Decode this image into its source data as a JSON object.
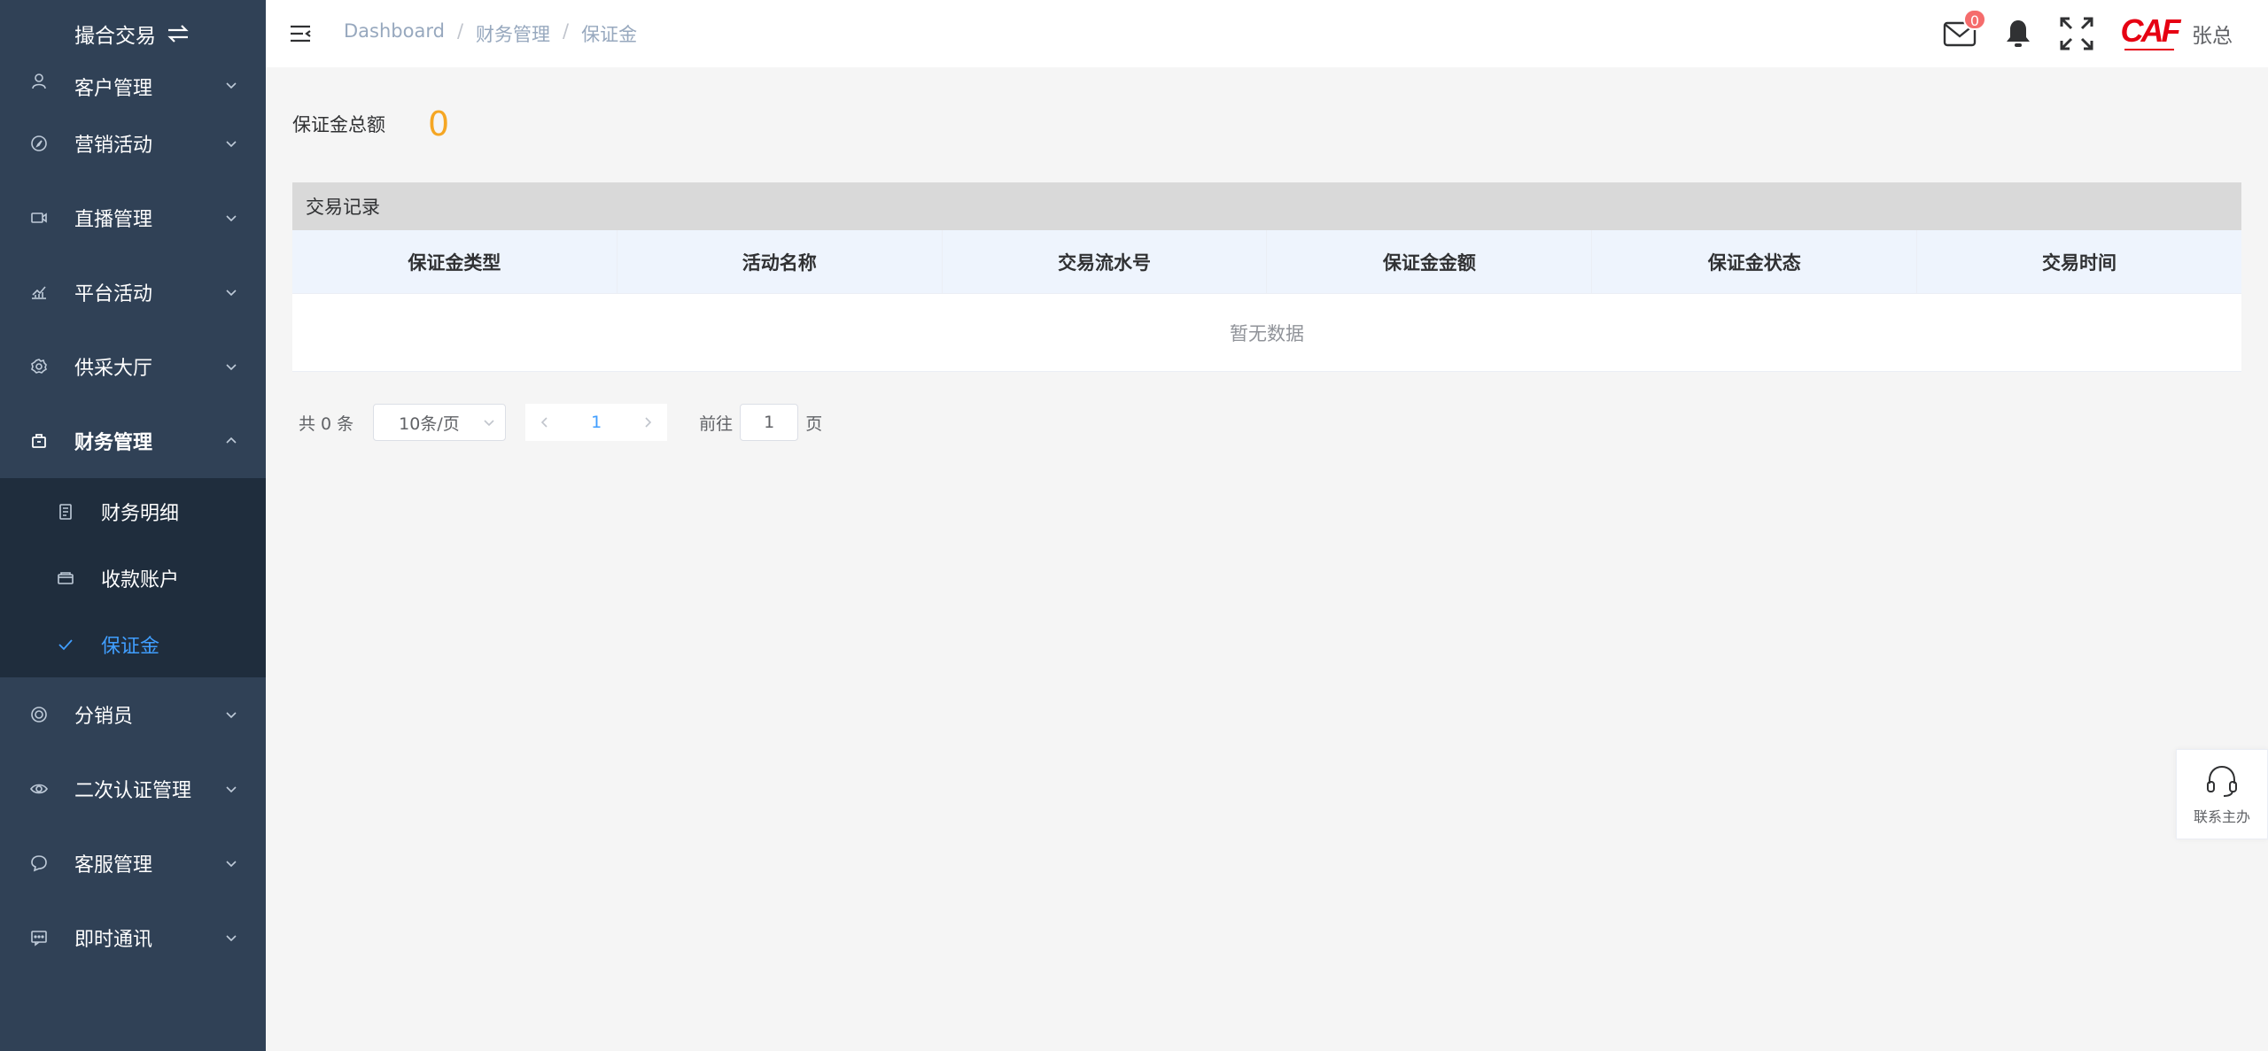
{
  "sidebar": {
    "brand": "撮合交易",
    "items": [
      {
        "label": "客户管理",
        "icon": "user-icon"
      },
      {
        "label": "营销活动",
        "icon": "compass-icon"
      },
      {
        "label": "直播管理",
        "icon": "video-icon"
      },
      {
        "label": "平台活动",
        "icon": "chart-icon"
      },
      {
        "label": "供采大厅",
        "icon": "gear-icon"
      },
      {
        "label": "财务管理",
        "icon": "wallet-icon"
      },
      {
        "label": "分销员",
        "icon": "target-icon"
      },
      {
        "label": "二次认证管理",
        "icon": "eye-icon"
      },
      {
        "label": "客服管理",
        "icon": "chat-icon"
      },
      {
        "label": "即时通讯",
        "icon": "message-icon"
      }
    ],
    "finance_sub": [
      {
        "label": "财务明细",
        "icon": "document-icon"
      },
      {
        "label": "收款账户",
        "icon": "card-icon"
      },
      {
        "label": "保证金",
        "icon": "check-icon"
      }
    ]
  },
  "header": {
    "breadcrumb": [
      "Dashboard",
      "财务管理",
      "保证金"
    ],
    "mail_badge": "0",
    "logo_text": "CAF",
    "username": "张总"
  },
  "main": {
    "total_label": "保证金总额",
    "total_value": "0",
    "table_title": "交易记录",
    "columns": [
      "保证金类型",
      "活动名称",
      "交易流水号",
      "保证金金额",
      "保证金状态",
      "交易时间"
    ],
    "empty_text": "暂无数据",
    "pager": {
      "total": "共 0 条",
      "size": "10条/页",
      "current": "1",
      "goto_label": "前往",
      "goto_value": "1",
      "page_suffix": "页"
    }
  },
  "float": {
    "contact_label": "联系主办"
  },
  "colors": {
    "sidebar_bg": "#304156",
    "submenu_bg": "#1f2d3d",
    "active": "#409eff",
    "total_value": "#f5a623",
    "badge": "#f56c6c"
  }
}
